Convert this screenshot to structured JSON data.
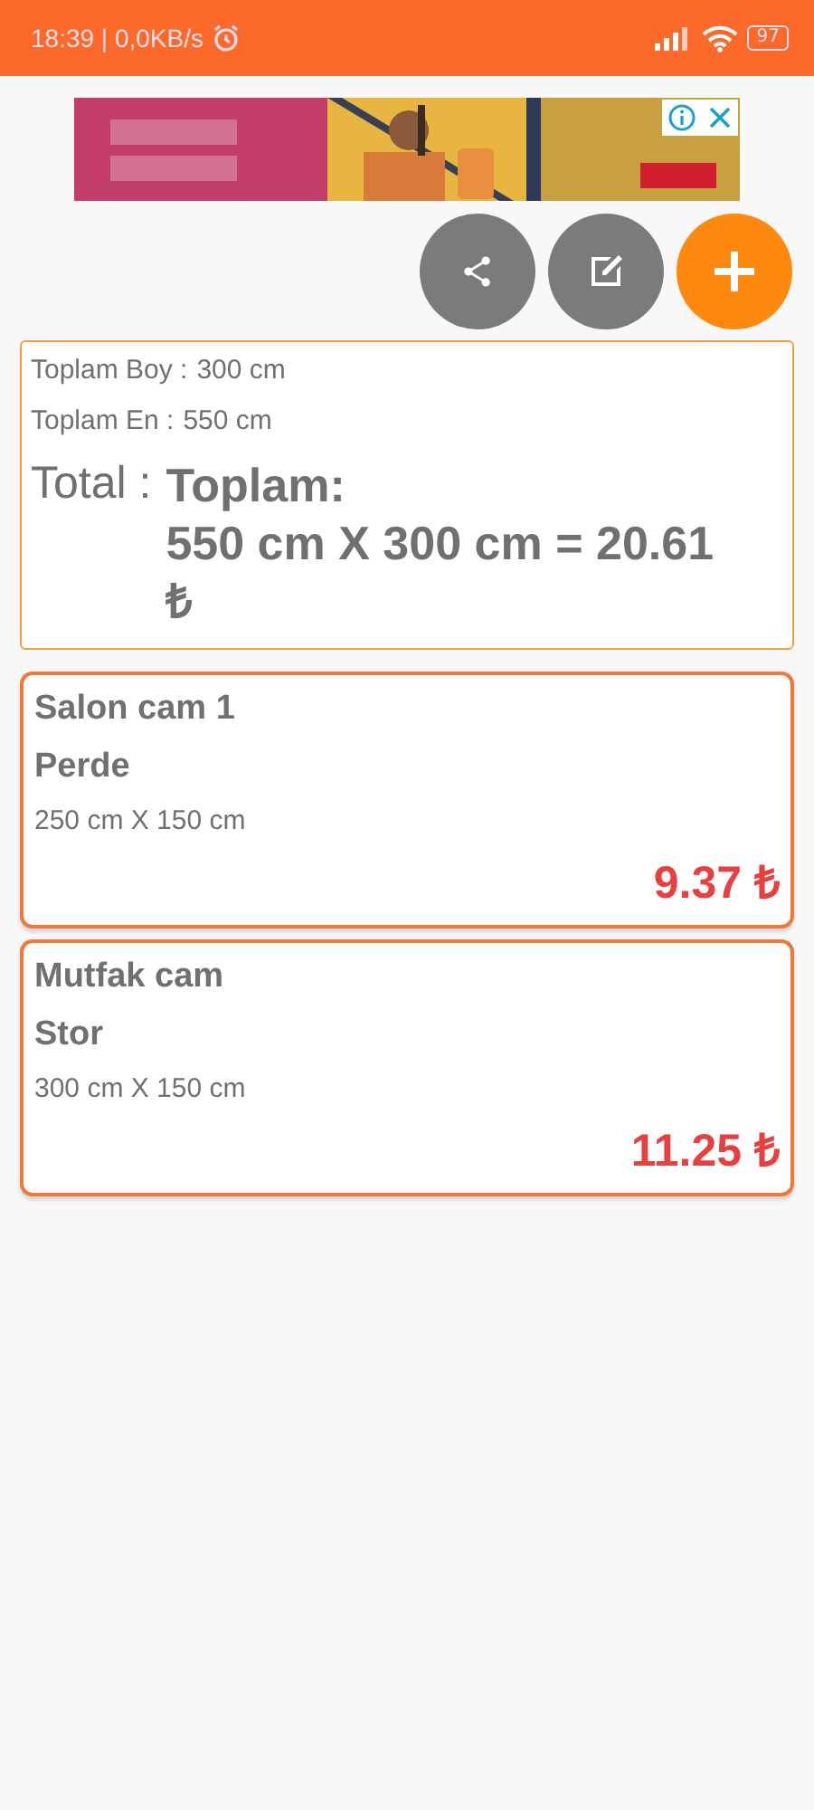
{
  "status_bar": {
    "time": "18:39 | 0,0KB/s",
    "battery": "97"
  },
  "actions": [
    {
      "kind": "share"
    },
    {
      "kind": "edit"
    },
    {
      "kind": "add"
    }
  ],
  "summary": {
    "rows": [
      {
        "label": "Toplam Boy :",
        "value": "300 cm"
      },
      {
        "label": "Toplam En :",
        "value": "550 cm"
      }
    ],
    "total_label": "Total :",
    "total_heading": "Toplam:",
    "total_value": "550 cm X 300 cm = 20.61 ₺"
  },
  "items": [
    {
      "name": "Salon cam 1",
      "type": "Perde",
      "size": "250 cm X 150 cm",
      "price": "9.37 ₺"
    },
    {
      "name": "Mutfak cam",
      "type": "Stor",
      "size": "300 cm X 150 cm",
      "price": "11.25 ₺"
    }
  ]
}
